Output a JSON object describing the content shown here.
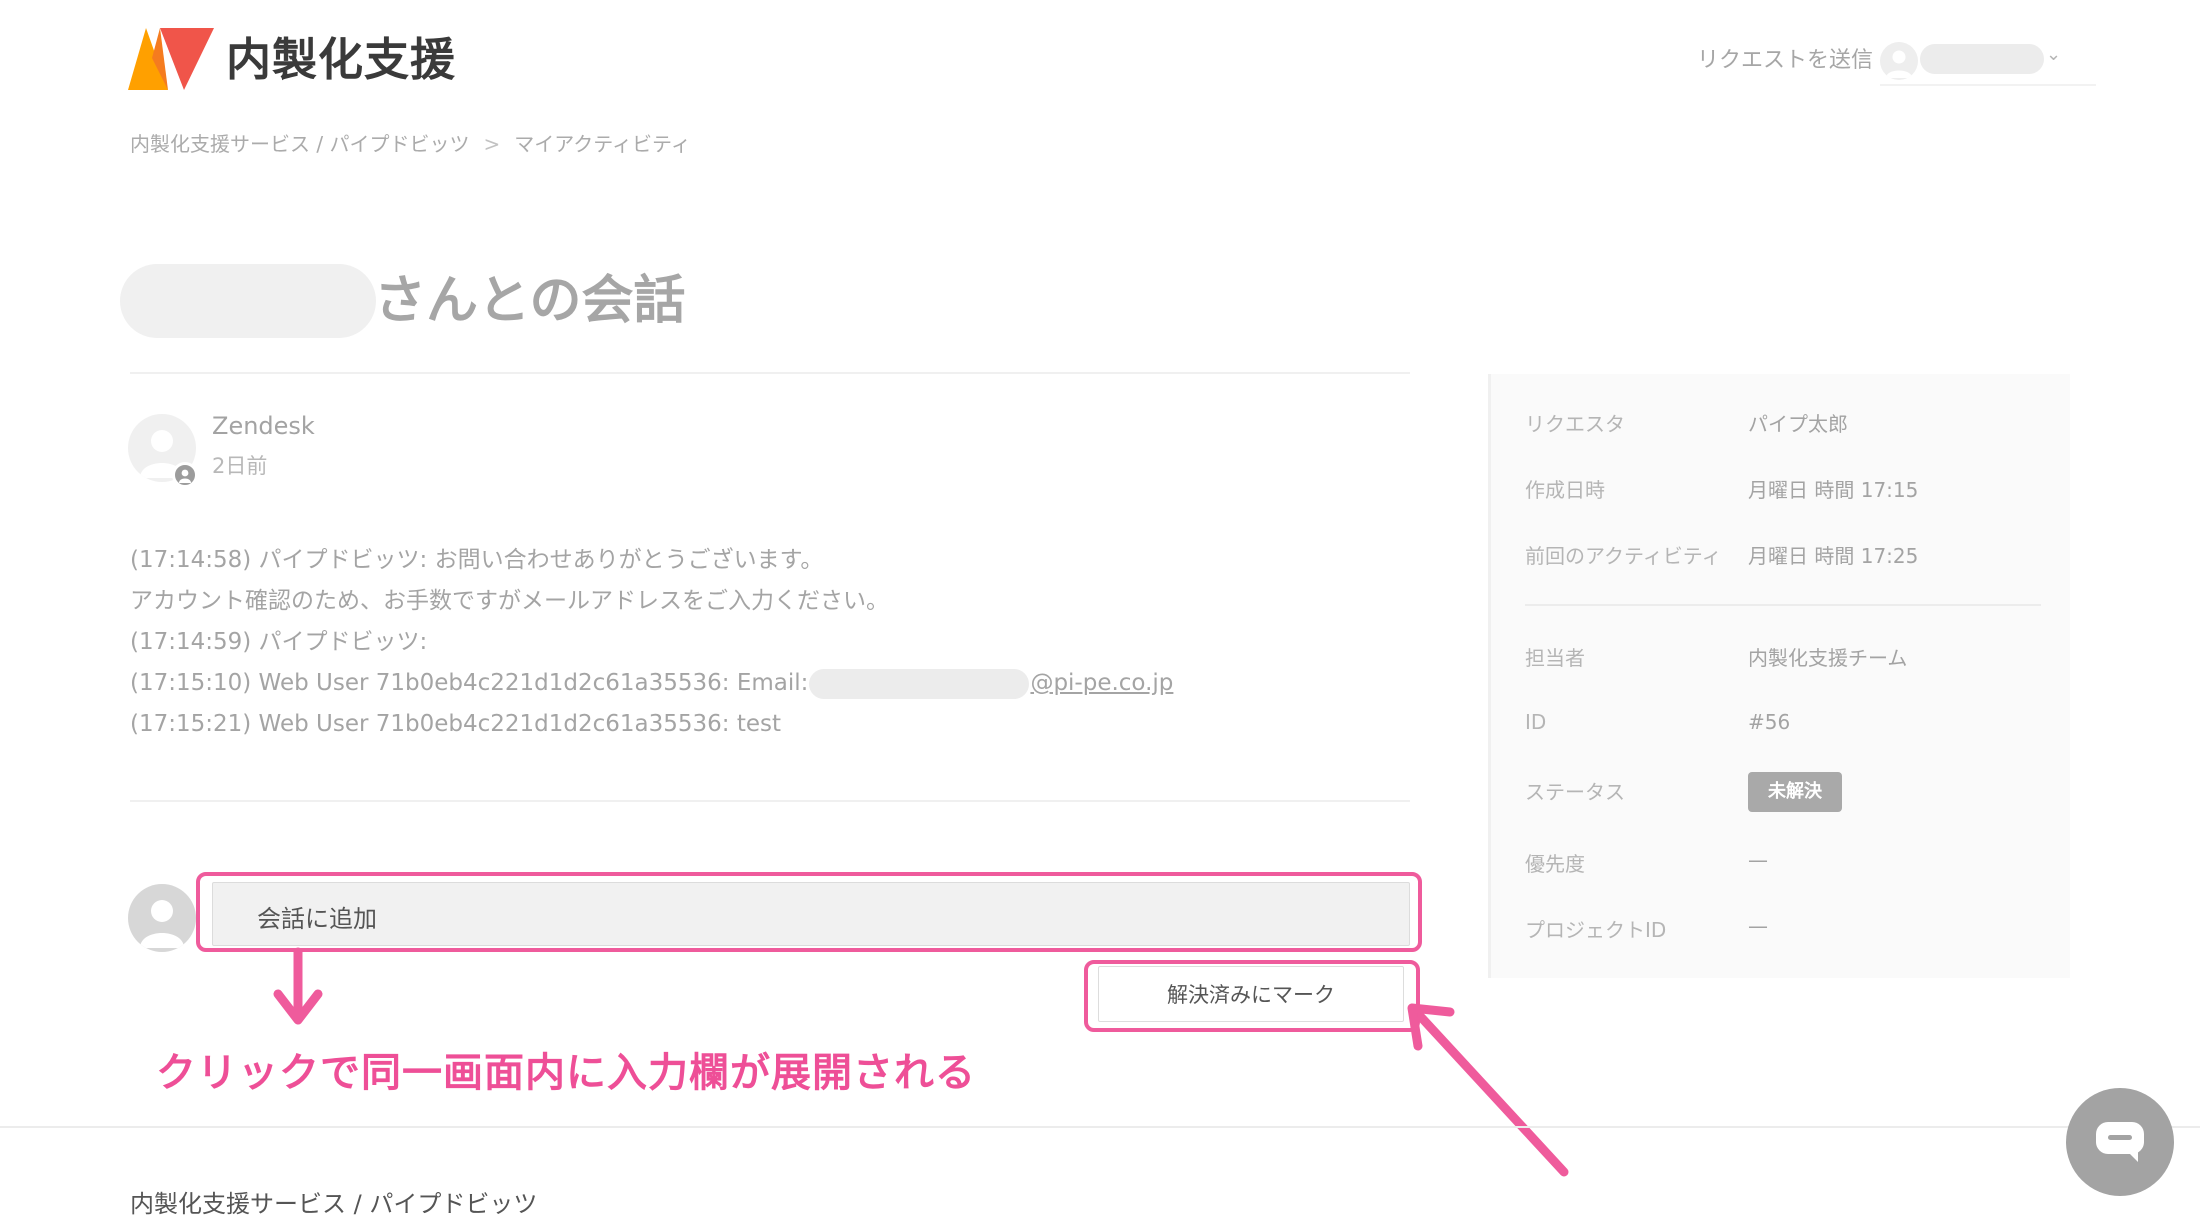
{
  "header": {
    "brand": "内製化支援",
    "request_link": "リクエストを送信",
    "user_menu_chevron": "⌄",
    "logo_colors": [
      "#ffa000",
      "#f0554a"
    ]
  },
  "breadcrumb": {
    "home": "内製化支援サービス / パイプドビッツ",
    "separator": ">",
    "current": "マイアクティビティ"
  },
  "page": {
    "title_suffix": "さんとの会話"
  },
  "comment": {
    "author": "Zendesk",
    "time": "2日前",
    "lines": [
      "(17:14:58) パイプドビッツ: お問い合わせありがとうございます。",
      "アカウント確認のため、お手数ですがメールアドレスをご入力ください。",
      "(17:14:59) パイプドビッツ:",
      "(17:15:10) Web User 71b0eb4c221d1d2c61a35536: Email:",
      "(17:15:21) Web User 71b0eb4c221d1d2c61a35536: test"
    ],
    "email_domain": "@pi-pe.co.jp"
  },
  "reply": {
    "add_comment_label": "会話に追加",
    "resolve_button": "解決済みにマーク"
  },
  "annotation": {
    "text": "クリックで同一画面内に入力欄が展開される",
    "color": "#ee4f97"
  },
  "sidebar": {
    "requester_label": "リクエスタ",
    "requester_value": "パイプ太郎",
    "created_label": "作成日時",
    "created_value": "月曜日 時間 17:15",
    "last_activity_label": "前回のアクティビティ",
    "last_activity_value": "月曜日 時間 17:25",
    "assignee_label": "担当者",
    "assignee_value": "内製化支援チーム",
    "id_label": "ID",
    "id_value": "#56",
    "status_label": "ステータス",
    "status_value": "未解決",
    "priority_label": "優先度",
    "priority_value": "—",
    "project_label": "プロジェクトID",
    "project_value": "—"
  },
  "footer": {
    "text": "内製化支援サービス / パイプドビッツ"
  }
}
